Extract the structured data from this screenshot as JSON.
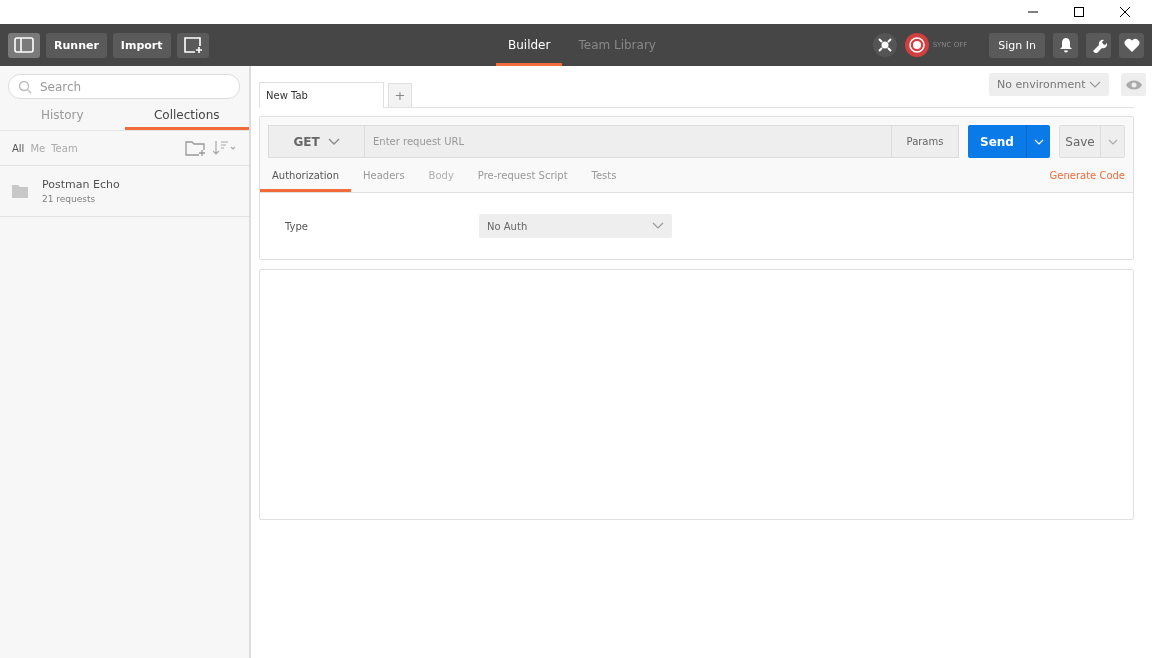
{
  "toolbar": {
    "buttons": [
      {
        "label": "Runner"
      },
      {
        "label": "Import"
      }
    ],
    "center_tabs": [
      {
        "label": "Builder",
        "selected": true
      },
      {
        "label": "Team Library",
        "selected": false
      }
    ],
    "sync": {
      "label": "SYNC OFF"
    },
    "sign_in": "Sign In"
  },
  "sidebar": {
    "search": {
      "placeholder": "Search"
    },
    "tabs": [
      {
        "label": "History",
        "selected": false
      },
      {
        "label": "Collections",
        "selected": true
      }
    ],
    "filters": [
      {
        "label": "All",
        "selected": true
      },
      {
        "label": "Me",
        "selected": false
      },
      {
        "label": "Team",
        "selected": false
      }
    ],
    "collections": [
      {
        "name": "Postman Echo",
        "count": "21 requests"
      }
    ]
  },
  "request_tabs": [
    {
      "label": "New Tab",
      "selected": true
    }
  ],
  "add_tab": "+",
  "environment": {
    "value": "No environment"
  },
  "request": {
    "method": "GET",
    "url": {
      "placeholder": "Enter request URL"
    },
    "params": "Params",
    "send": "Send",
    "save": "Save",
    "tabs": [
      {
        "label": "Authorization",
        "selected": true,
        "disabled": false
      },
      {
        "label": "Headers",
        "selected": false,
        "disabled": false
      },
      {
        "label": "Body",
        "selected": false,
        "disabled": true
      },
      {
        "label": "Pre-request Script",
        "selected": false,
        "disabled": false
      },
      {
        "label": "Tests",
        "selected": false,
        "disabled": false
      }
    ],
    "generate_code": "Generate Code",
    "auth": {
      "label": "Type",
      "value": "No Auth"
    }
  }
}
